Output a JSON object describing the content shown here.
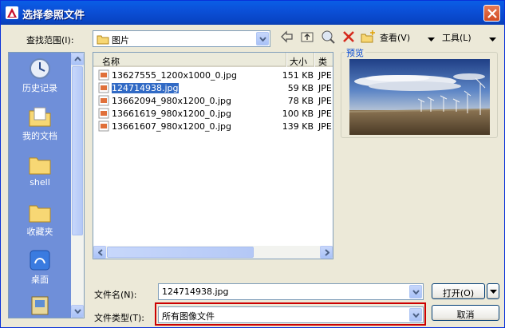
{
  "title": "选择参照文件",
  "lookin": {
    "label": "查找范围(I):",
    "value": "图片"
  },
  "toolbar": {
    "views_label": "查看(V)",
    "tools_label": "工具(L)"
  },
  "places": [
    {
      "label": "历史记录",
      "icon": "history-icon"
    },
    {
      "label": "我的文档",
      "icon": "my-documents-icon"
    },
    {
      "label": "shell",
      "icon": "folder-icon"
    },
    {
      "label": "收藏夹",
      "icon": "folder-icon"
    },
    {
      "label": "桌面",
      "icon": "desktop-icon"
    }
  ],
  "files": {
    "columns": {
      "name": "名称",
      "size": "大小",
      "type": "类"
    },
    "rows": [
      {
        "name": "13627555_1200x1000_0.jpg",
        "size": "151 KB",
        "type": "JPE"
      },
      {
        "name": "124714938.jpg",
        "size": "59 KB",
        "type": "JPE",
        "selected": true
      },
      {
        "name": "13662094_980x1200_0.jpg",
        "size": "78 KB",
        "type": "JPE"
      },
      {
        "name": "13661619_980x1200_0.jpg",
        "size": "100 KB",
        "type": "JPE"
      },
      {
        "name": "13661607_980x1200_0.jpg",
        "size": "139 KB",
        "type": "JPE"
      }
    ]
  },
  "preview": {
    "label": "预览"
  },
  "filename": {
    "label": "文件名(N):",
    "value": "124714938.jpg"
  },
  "filetype": {
    "label": "文件类型(T):",
    "value": "所有图像文件"
  },
  "buttons": {
    "open": "打开(O)",
    "cancel": "取消"
  },
  "colors": {
    "titlebar": "#0a5ee6",
    "selection": "#316ac5",
    "places_bg": "#6f8fd9",
    "highlight_border": "#cc0000"
  }
}
